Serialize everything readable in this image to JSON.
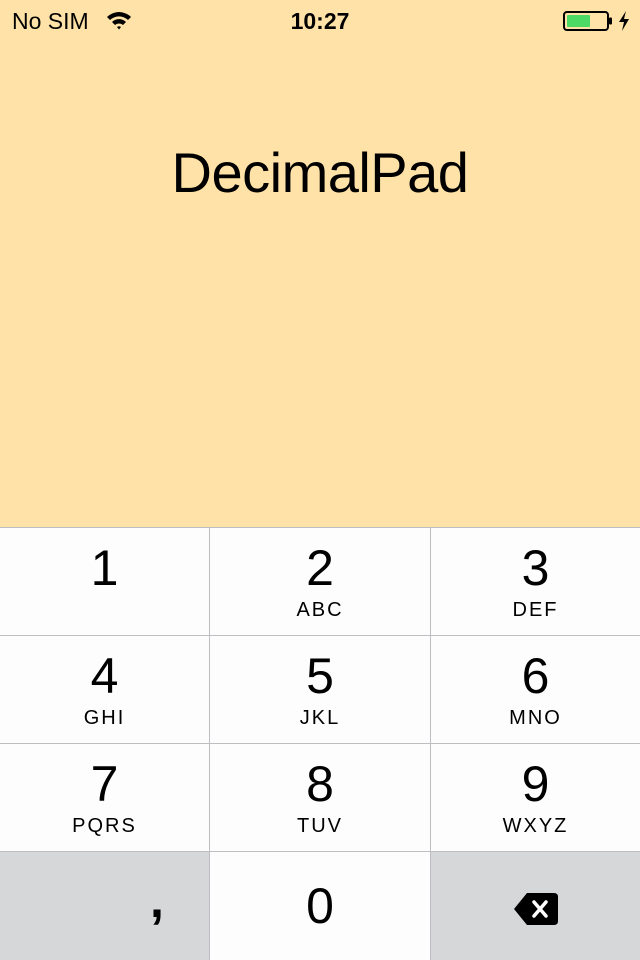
{
  "status_bar": {
    "carrier": "No SIM",
    "time": "10:27",
    "wifi_icon": "wifi-icon",
    "battery_icon": "battery-icon",
    "charging_icon": "bolt-icon",
    "battery_level": 0.6,
    "battery_color": "#4CD964"
  },
  "main": {
    "title": "DecimalPad"
  },
  "keypad": {
    "keys": [
      {
        "digit": "1",
        "letters": ""
      },
      {
        "digit": "2",
        "letters": "ABC"
      },
      {
        "digit": "3",
        "letters": "DEF"
      },
      {
        "digit": "4",
        "letters": "GHI"
      },
      {
        "digit": "5",
        "letters": "JKL"
      },
      {
        "digit": "6",
        "letters": "MNO"
      },
      {
        "digit": "7",
        "letters": "PQRS"
      },
      {
        "digit": "8",
        "letters": "TUV"
      },
      {
        "digit": "9",
        "letters": "WXYZ"
      }
    ],
    "decimal_label": ",",
    "zero": "0",
    "backspace_icon": "backspace-icon"
  },
  "colors": {
    "background": "#FFE2A7",
    "key": "#FDFDFD",
    "function_key": "#D6D7D8",
    "separator": "#BCBEC1"
  }
}
